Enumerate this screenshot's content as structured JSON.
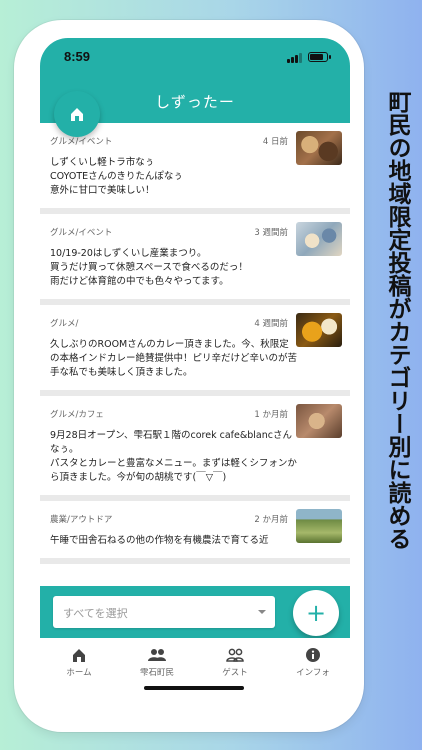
{
  "status_bar": {
    "time": "8:59"
  },
  "header": {
    "title": "しずったー"
  },
  "feed": [
    {
      "category": "グルメ/イベント",
      "time": "4 日前",
      "body": "しずくいし軽トラ市なぅ\nCOYOTEさんのきりたんぽなぅ\n意外に甘口で美味しい！",
      "thumb_color": "#8a5a34"
    },
    {
      "category": "グルメ/イベント",
      "time": "3 週間前",
      "body": "10/19-20はしずくいし産業まつり。\n買うだけ買って休憩スペースで食べるのだっ！\n雨だけど体育館の中でも色々やってます。",
      "thumb_color": "#9fb6c6"
    },
    {
      "category": "グルメ/",
      "time": "4 週間前",
      "body": "久しぶりのROOMさんのカレー頂きました。今、秋限定の本格インドカレー絶賛提供中！ピリ辛だけど辛いのが苦手な私でも美味しく頂きました。",
      "thumb_color": "#c98a1c"
    },
    {
      "category": "グルメ/カフェ",
      "time": "1 か月前",
      "body": "9月28日オープン、雫石駅１階のcorek cafe&blancさんなぅ。\nパスタとカレーと豊富なメニュー。まずは軽くシフォンから頂きました。今が旬の胡桃です(￣▽￣)",
      "thumb_color": "#a7745a"
    },
    {
      "category": "農業/アウトドア",
      "time": "2 か月前",
      "body": "午睡で田舎石ねるの他の作物を有機農法で育てる近",
      "thumb_color": "#7f9a52"
    }
  ],
  "filter": {
    "placeholder": "すべてを選択"
  },
  "add_button": {
    "label": "+"
  },
  "nav": {
    "items": [
      {
        "label": "ホーム",
        "icon": "home-icon"
      },
      {
        "label": "雫石町民",
        "icon": "people-icon"
      },
      {
        "label": "ゲスト",
        "icon": "guest-icon"
      },
      {
        "label": "インフォ",
        "icon": "info-icon"
      }
    ]
  },
  "side_caption": "町民の地域限定投稿がカテゴリー別に読める",
  "colors": {
    "accent": "#23b0a8"
  }
}
